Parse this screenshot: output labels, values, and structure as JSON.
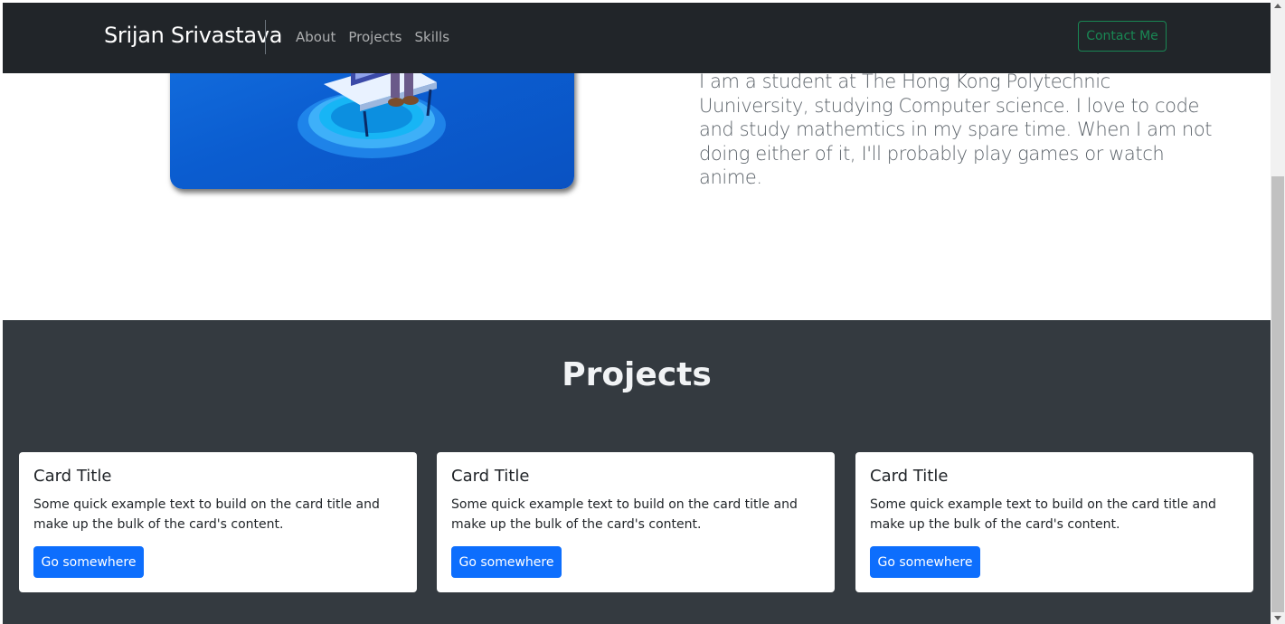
{
  "navbar": {
    "brand": "Srijan Srivastava",
    "links": [
      "About",
      "Projects",
      "Skills"
    ],
    "contact_label": "Contact Me"
  },
  "about": {
    "text": "I am a student at The Hong Kong Polytechnic Uuniversity, studying Computer science. I love to code and study mathemtics in my spare time. When I am not doing either of it, I'll probably play games or watch anime."
  },
  "projects": {
    "heading": "Projects",
    "cards": [
      {
        "title": "Card Title",
        "text": "Some quick example text to build on the card title and make up the bulk of the card's content.",
        "button": "Go somewhere"
      },
      {
        "title": "Card Title",
        "text": "Some quick example text to build on the card title and make up the bulk of the card's content.",
        "button": "Go somewhere"
      },
      {
        "title": "Card Title",
        "text": "Some quick example text to build on the card title and make up the bulk of the card's content.",
        "button": "Go somewhere"
      }
    ]
  },
  "colors": {
    "navbar_bg": "#212529",
    "section_bg": "#343a40",
    "primary": "#0d6efd",
    "success": "#198754"
  },
  "icons": [
    "isometric-illustration"
  ]
}
